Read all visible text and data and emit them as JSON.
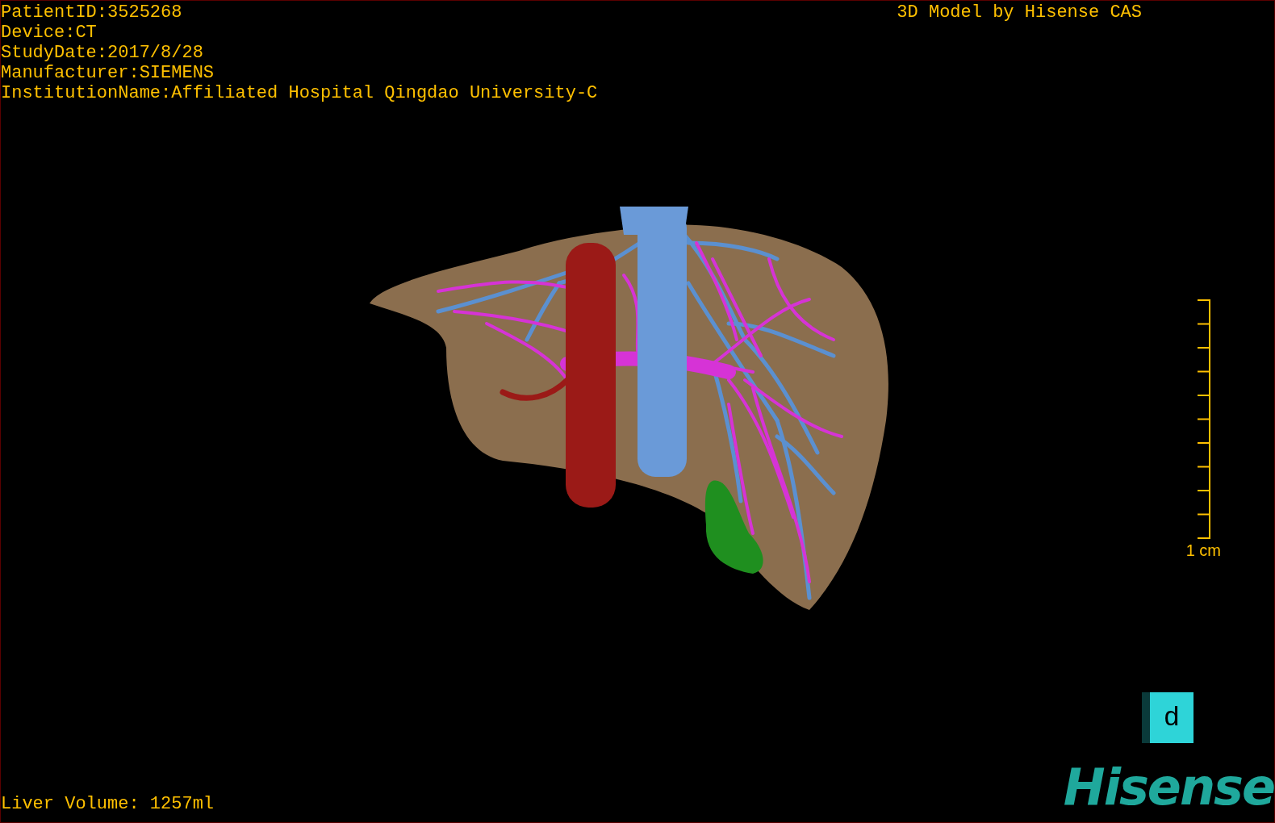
{
  "patient_info": [
    "PatientID:3525268",
    "Device:CT",
    "StudyDate:2017/8/28",
    "Manufacturer:SIEMENS",
    "InstitutionName:Affiliated Hospital Qingdao University-C"
  ],
  "model_title": "3D Model by Hisense CAS",
  "scale_bar": {
    "label": "1 cm"
  },
  "liver_volume": "Liver Volume: 1257ml",
  "orientation_cube": {
    "label": "d"
  },
  "logo": "Hisense"
}
